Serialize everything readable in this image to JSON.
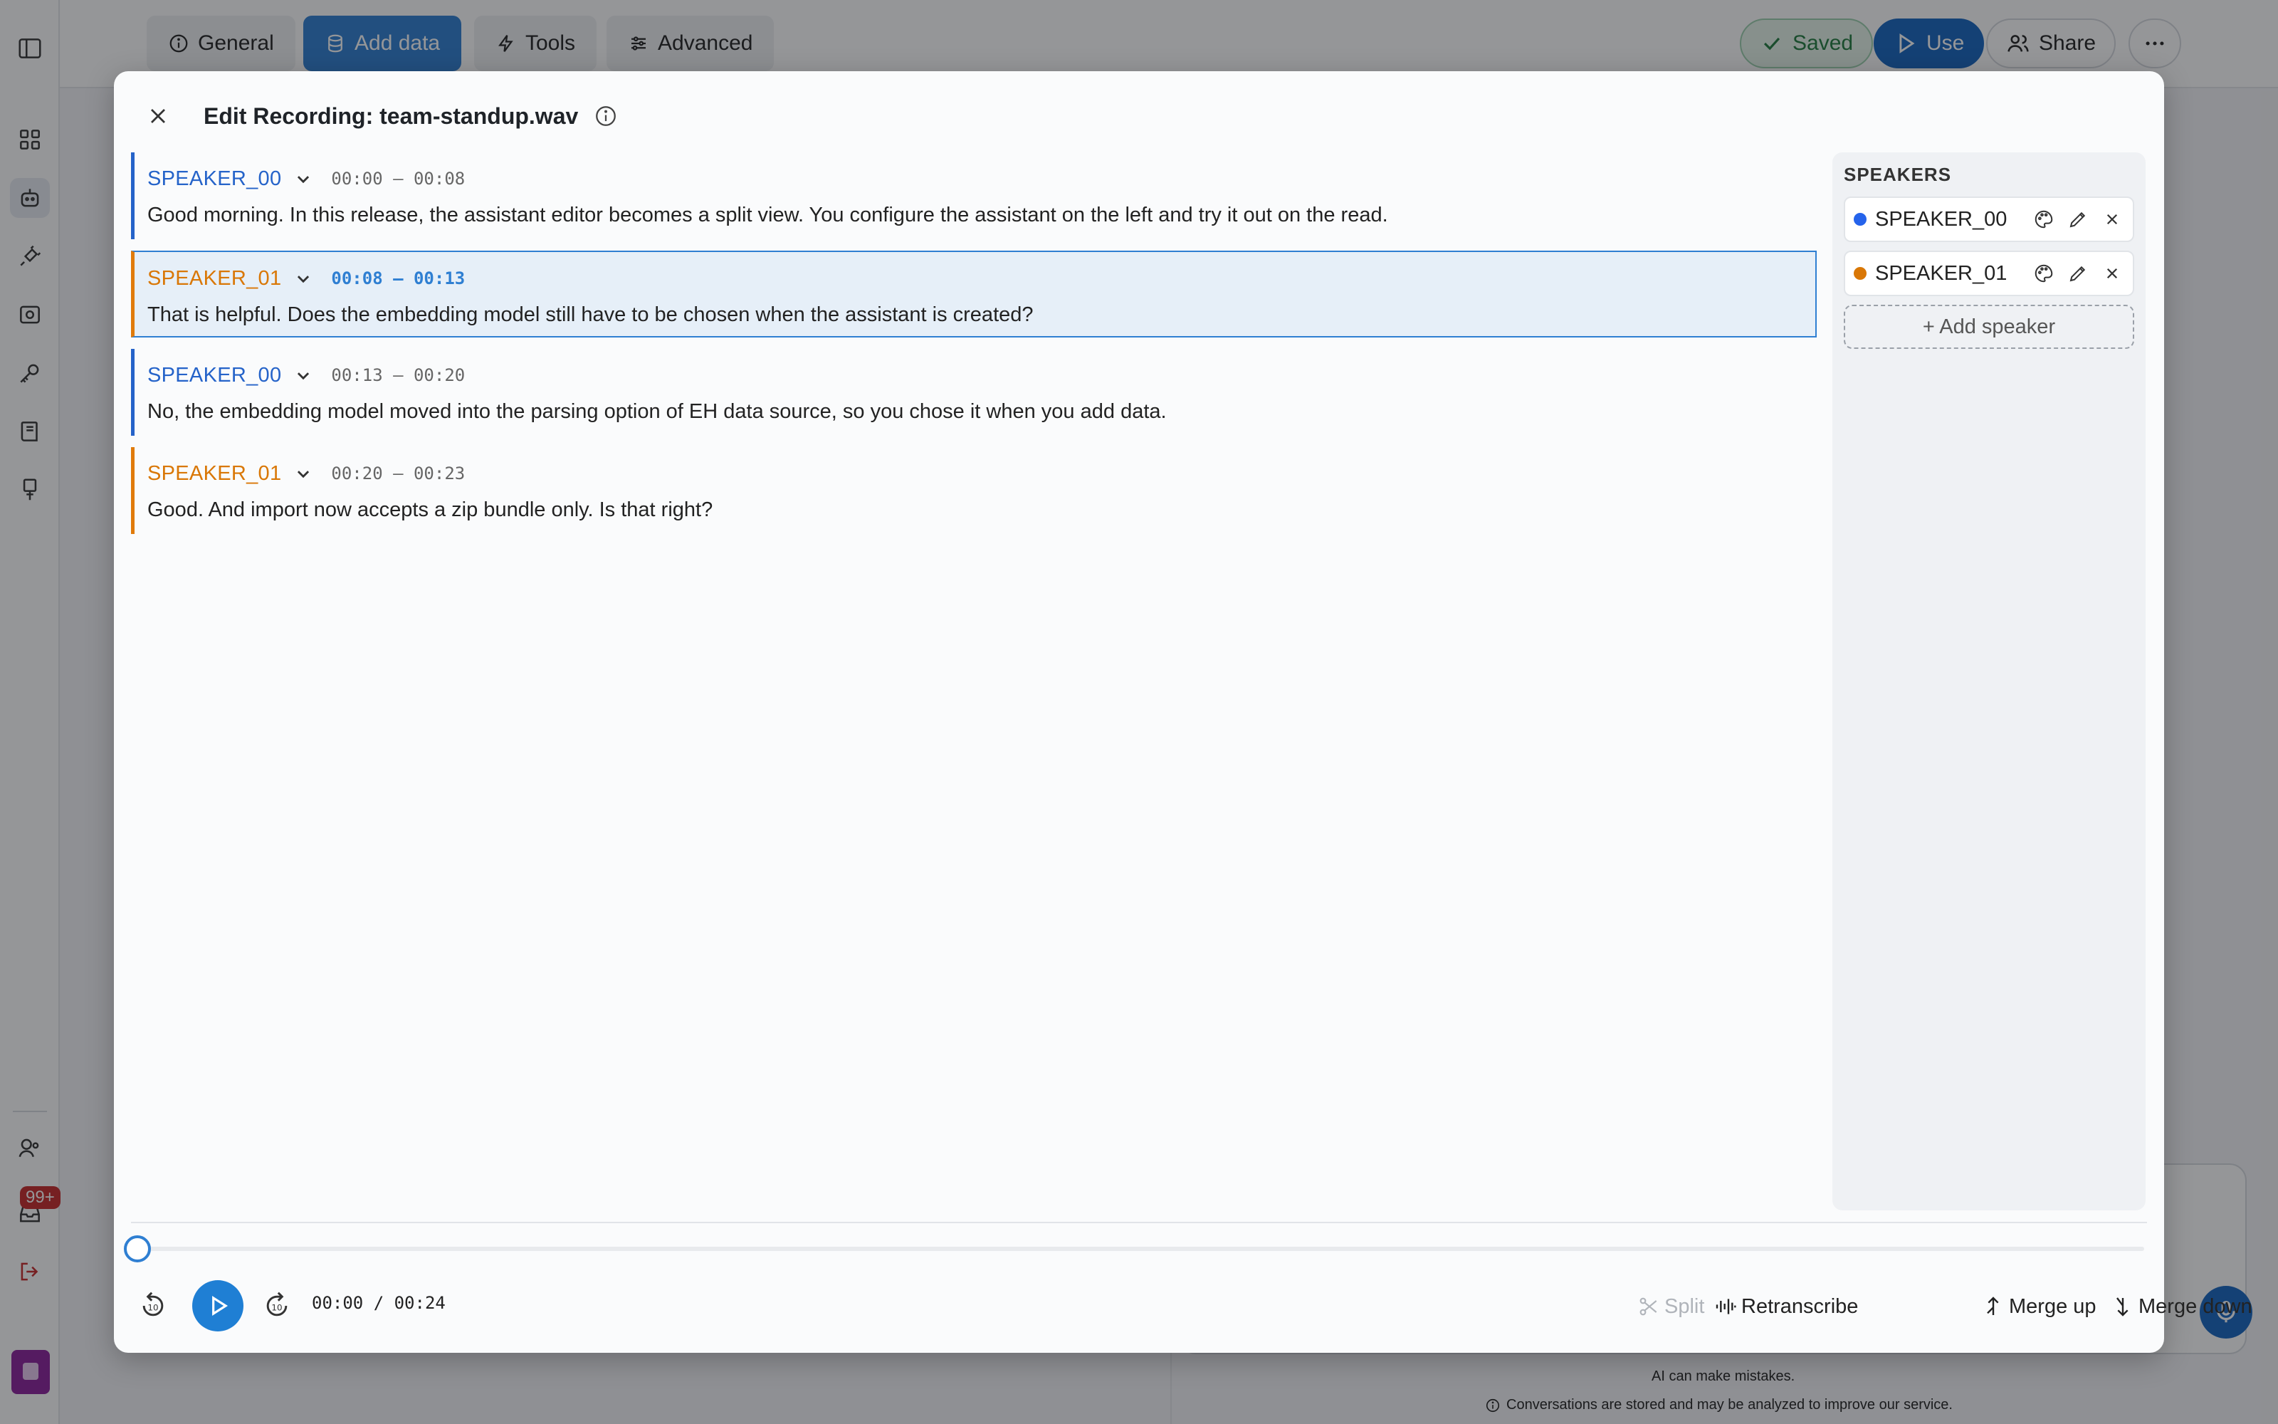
{
  "app": {
    "tabs": [
      {
        "label": "General",
        "icon": "info-circle-icon"
      },
      {
        "label": "Add data",
        "icon": "database-icon",
        "active": true
      },
      {
        "label": "Tools",
        "icon": "bolt-icon"
      },
      {
        "label": "Advanced",
        "icon": "sliders-icon"
      }
    ],
    "saved_label": "Saved",
    "use_label": "Use",
    "share_label": "Share",
    "notification_count": "99+",
    "footer": {
      "disclaimer": "AI can make mistakes.",
      "privacy": "Conversations are stored and may be analyzed to improve our service."
    }
  },
  "modal": {
    "title": "Edit Recording: team-standup.wav",
    "segments": [
      {
        "speaker": "SPEAKER_00",
        "time": "00:00 – 00:08",
        "text": "Good morning. In this release, the assistant editor becomes a split view. You configure the assistant on the left and try it out on the read."
      },
      {
        "speaker": "SPEAKER_01",
        "time": "00:08 – 00:13",
        "text": "That is helpful. Does the embedding model still have to be chosen when the assistant is created?",
        "selected": true
      },
      {
        "speaker": "SPEAKER_00",
        "time": "00:13 – 00:20",
        "text": "No, the embedding model moved into the parsing option of EH data source, so you chose it when you add data."
      },
      {
        "speaker": "SPEAKER_01",
        "time": "00:20 – 00:23",
        "text": "Good. And import now accepts a zip bundle only. Is that right?"
      }
    ],
    "speakers_heading": "SPEAKERS",
    "speakers": [
      {
        "name": "SPEAKER_00",
        "color": "#2563eb"
      },
      {
        "name": "SPEAKER_01",
        "color": "#d97706"
      }
    ],
    "add_speaker_label": "+ Add speaker",
    "player": {
      "time": "00:00 / 00:24",
      "progress": 0,
      "split_label": "Split",
      "retranscribe_label": "Retranscribe",
      "merge_up_label": "Merge up",
      "merge_down_label": "Merge down"
    }
  },
  "colors": {
    "accent": "#2f7fd2",
    "speaker_00": "#2563c9",
    "speaker_01": "#d97706"
  }
}
